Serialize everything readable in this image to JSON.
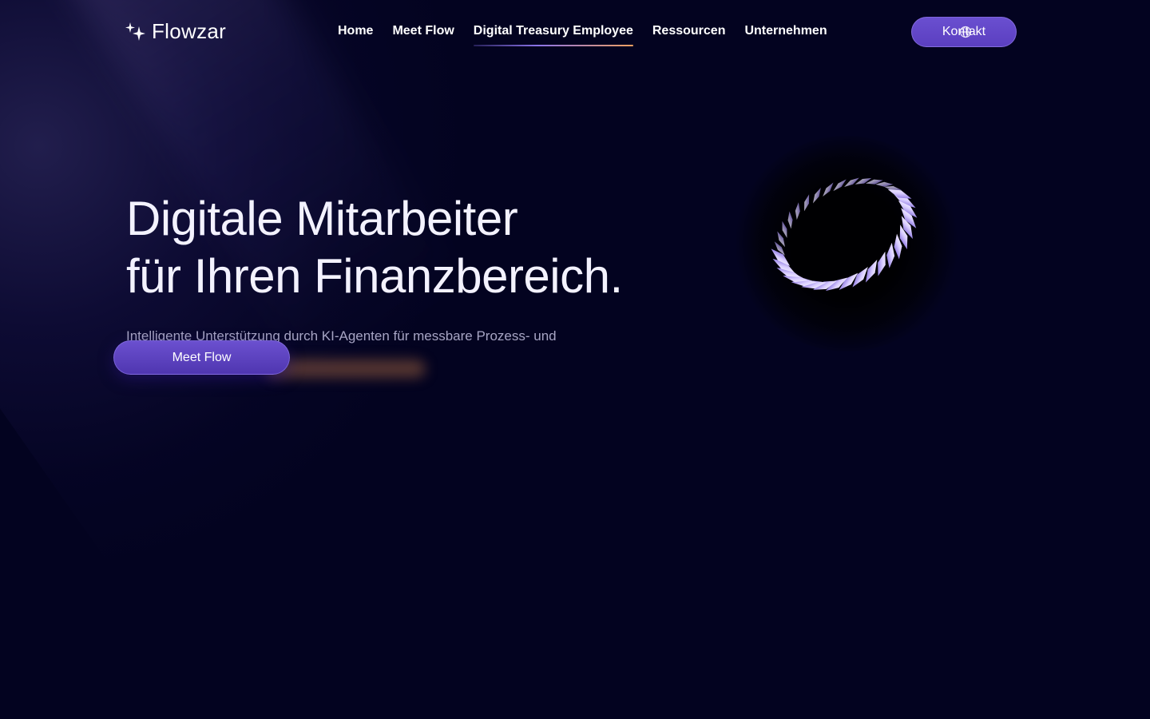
{
  "brand": {
    "name": "Flowzar",
    "logo_icon": "sparkle-icon"
  },
  "nav": {
    "items": [
      {
        "label": "Home",
        "active": false
      },
      {
        "label": "Meet Flow",
        "active": false
      },
      {
        "label": "Digital Treasury Employee",
        "active": true
      },
      {
        "label": "Ressourcen",
        "active": false
      },
      {
        "label": "Unternehmen",
        "active": false
      }
    ],
    "contact_label": "Kontakt",
    "contact_icon": "globe-icon"
  },
  "hero": {
    "title_line1": "Digitale Mitarbeiter",
    "title_line2": "für Ihren Finanzbereich.",
    "subtitle": "Intelligente Unterstützung durch KI-Agenten für messbare Prozess- und",
    "cta_label": "Meet Flow"
  },
  "colors": {
    "background": "#030320",
    "accent": "#5b3fc0",
    "accent_light": "#8a73e8",
    "highlight": "#f0a060"
  }
}
